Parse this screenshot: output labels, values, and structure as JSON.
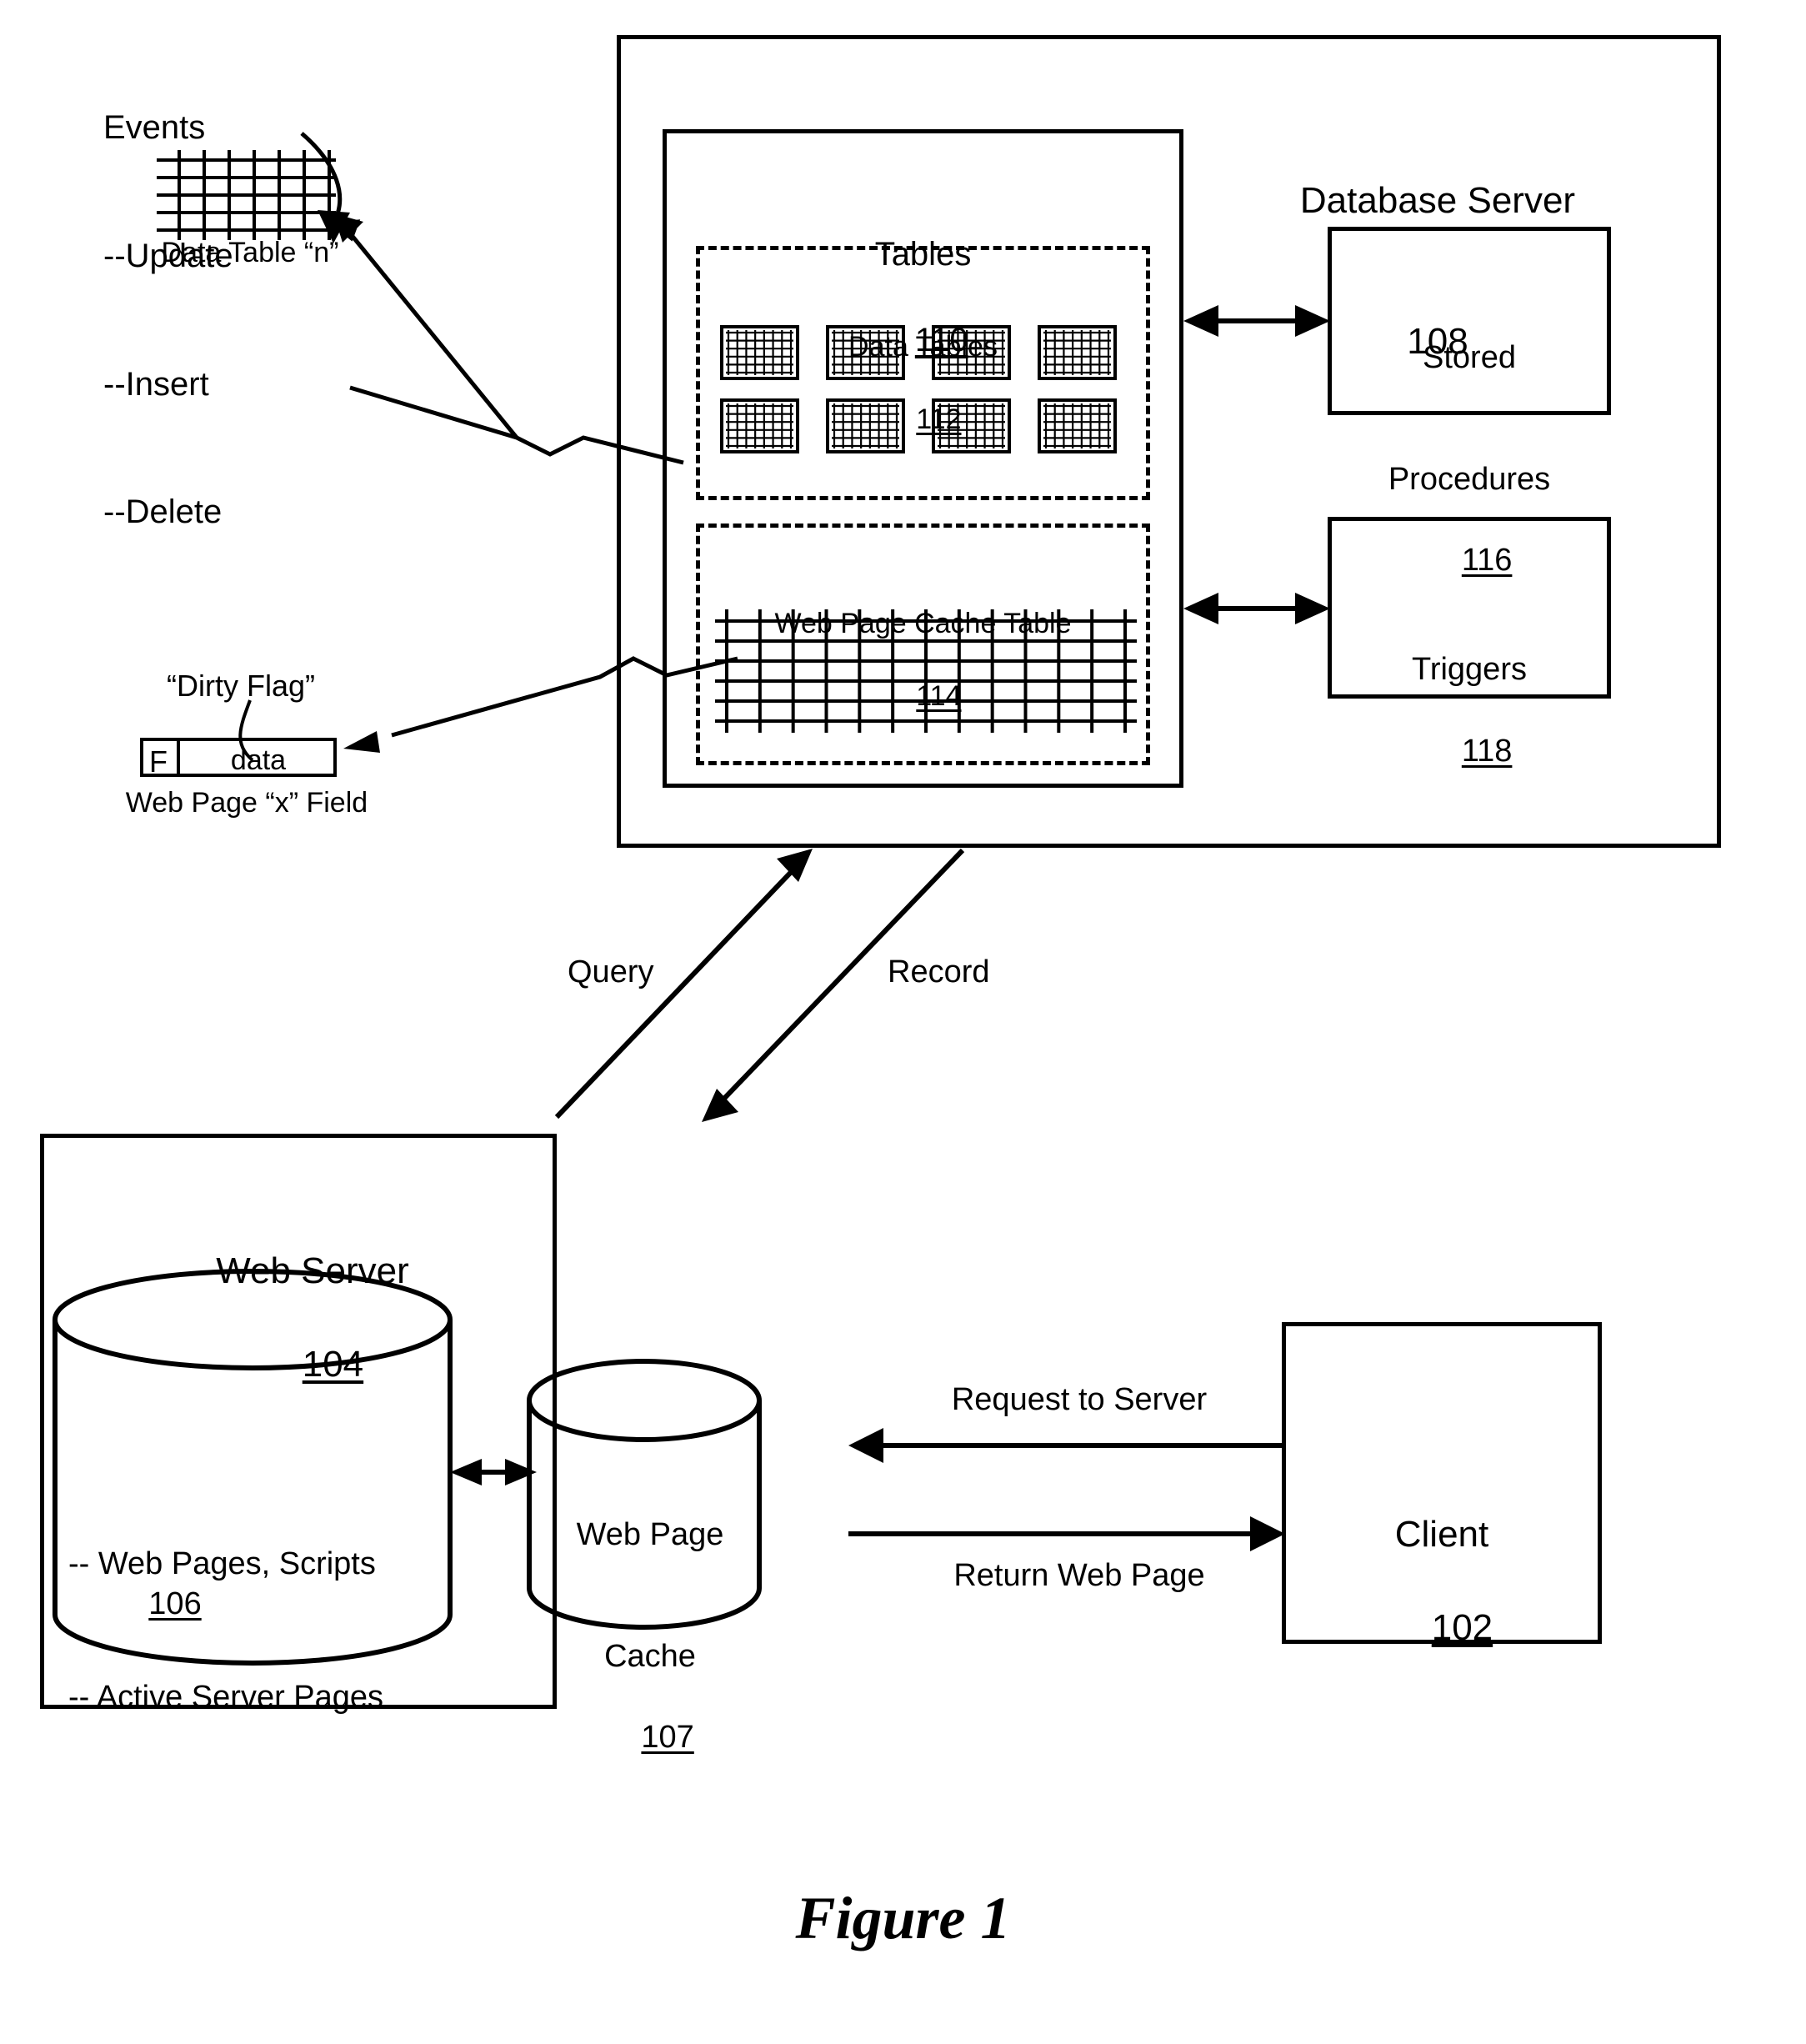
{
  "figure": {
    "caption": "Figure 1"
  },
  "events_note": {
    "title": "Events",
    "items": [
      "--Update",
      "--Insert",
      "--Delete"
    ]
  },
  "data_table_n": {
    "caption": "Data Table “n”",
    "columns": 7,
    "rows": 5
  },
  "dirty_flag": {
    "callout": "“Dirty Flag”",
    "flag_value": "F",
    "data_label": "data",
    "caption": "Web Page “x” Field"
  },
  "database_server": {
    "title": "Database Server",
    "ref": "108",
    "tables": {
      "title": "Tables",
      "ref": "110",
      "data_tables": {
        "title": "Data Tables",
        "ref": "112",
        "thumbnails": 8,
        "thumb_cols": 7,
        "thumb_rows": 5
      },
      "web_page_cache_table": {
        "title": "Web Page Cache Table",
        "ref": "114",
        "columns": 12,
        "rows": 5
      }
    },
    "stored_procedures": {
      "line1": "Stored",
      "line2": "Procedures",
      "ref": "116"
    },
    "triggers": {
      "title": "Triggers",
      "ref": "118"
    }
  },
  "links": {
    "query": "Query",
    "record": "Record",
    "request_to_server": "Request to Server",
    "return_web_page": "Return Web Page"
  },
  "web_server": {
    "title": "Web Server",
    "ref": "104",
    "store": {
      "line1": "-- Web Pages, Scripts",
      "line2": "-- Active Server Pages",
      "ref": "106"
    },
    "cache": {
      "line1": "Web Page",
      "line2": "Cache",
      "ref": "107"
    }
  },
  "client": {
    "title": "Client",
    "ref": "102"
  }
}
